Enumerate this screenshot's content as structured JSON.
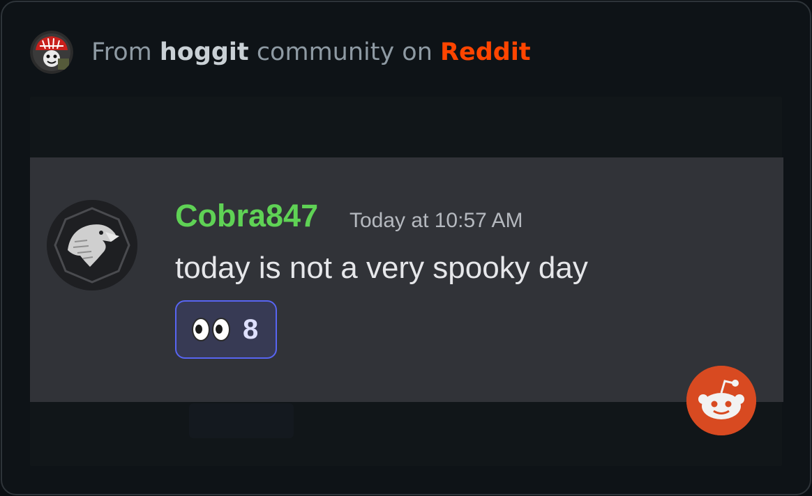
{
  "header": {
    "prefix": "From",
    "community": "hoggit",
    "middle": "community on",
    "platform": "Reddit"
  },
  "message": {
    "username": "Cobra847",
    "timestamp": "Today at 10:57 AM",
    "text": "today is not a very spooky day",
    "reaction": {
      "emoji": "eyes-icon",
      "count": "8"
    }
  },
  "colors": {
    "reddit_orange": "#ff4500",
    "username_green": "#5fd255",
    "reaction_border": "#5865f2"
  }
}
